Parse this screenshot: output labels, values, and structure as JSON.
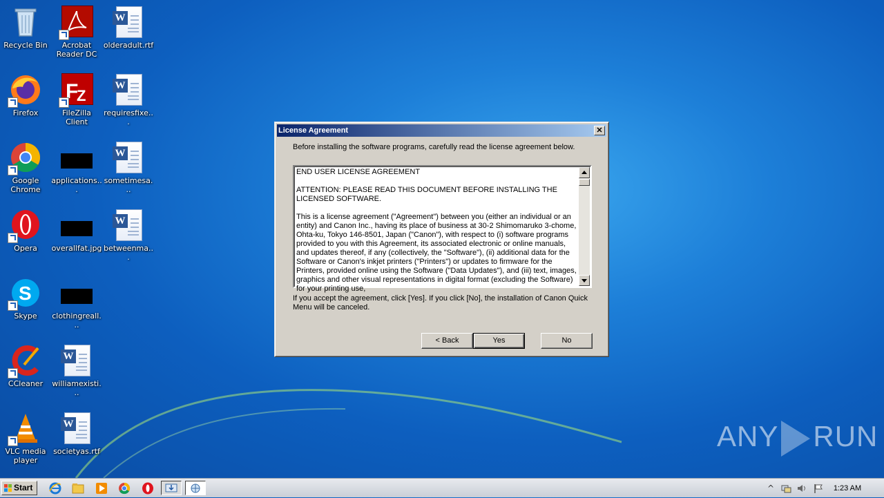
{
  "desktop": {
    "icons": [
      {
        "label": "Recycle Bin"
      },
      {
        "label": "Acrobat Reader DC"
      },
      {
        "label": "olderadult.rtf"
      },
      {
        "label": "Firefox"
      },
      {
        "label": "FileZilla Client"
      },
      {
        "label": "requiresfixe..."
      },
      {
        "label": "Google Chrome"
      },
      {
        "label": "applications..."
      },
      {
        "label": "sometimesa..."
      },
      {
        "label": "Opera"
      },
      {
        "label": "overallfat.jpg"
      },
      {
        "label": "betweenma..."
      },
      {
        "label": "Skype"
      },
      {
        "label": "clothingreall..."
      },
      {
        "label": "CCleaner"
      },
      {
        "label": "williamexisti..."
      },
      {
        "label": "VLC media player"
      },
      {
        "label": "societyas.rtf"
      }
    ]
  },
  "dialog": {
    "title": "License Agreement",
    "close_label": "✕",
    "intro": "Before installing the software programs, carefully read the license agreement below.",
    "license": {
      "heading": "END USER LICENSE AGREEMENT",
      "attention": "ATTENTION: PLEASE READ THIS DOCUMENT BEFORE INSTALLING THE LICENSED SOFTWARE.",
      "body": "This is a license agreement (\"Agreement\") between you (either an individual or an entity) and Canon Inc., having its place of business at 30-2 Shimomaruko 3-chome, Ohta-ku, Tokyo 146-8501, Japan (\"Canon\"), with respect to (i) software programs provided to you with this Agreement, its associated electronic or online manuals, and updates thereof, if any (collectively, the \"Software\"), (ii) additional data for the Software or Canon's inkjet printers (\"Printers\") or updates to firmware for the Printers, provided online using the Software (\"Data Updates\"), and (iii) text, images, graphics and other visual representations in digital format (excluding the Software) for your printing use,"
    },
    "accept_note": "If you accept the agreement, click [Yes]. If you click [No], the installation of Canon Quick Menu will be canceled.",
    "buttons": {
      "back": "< Back",
      "yes": "Yes",
      "no": "No"
    }
  },
  "watermark": {
    "left": "ANY",
    "right": "RUN"
  },
  "taskbar": {
    "start_label": "Start",
    "clock": "1:23 AM"
  }
}
